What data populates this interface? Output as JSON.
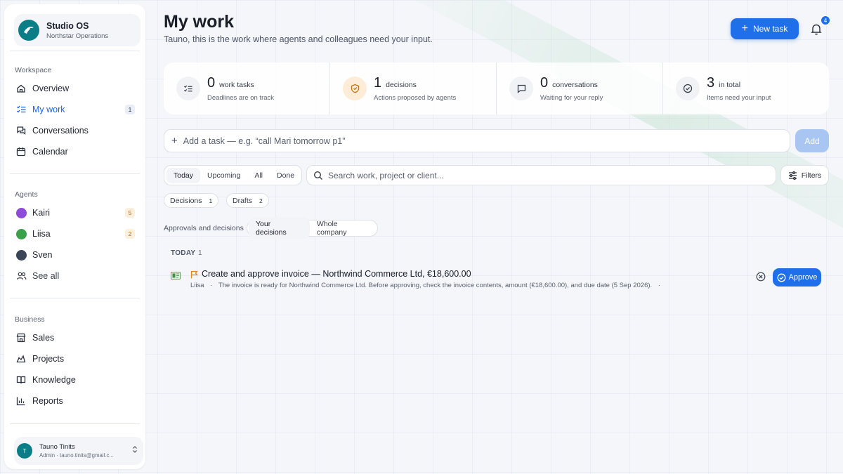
{
  "brand": {
    "name": "Studio OS",
    "org": "Northstar Operations"
  },
  "sidebar": {
    "workspace_label": "Workspace",
    "workspace_items": [
      {
        "label": "Overview",
        "icon": "home-icon"
      },
      {
        "label": "My work",
        "icon": "checklist-icon",
        "badge": "1",
        "active": true
      },
      {
        "label": "Conversations",
        "icon": "chat-icon"
      },
      {
        "label": "Calendar",
        "icon": "calendar-icon"
      }
    ],
    "agents_label": "Agents",
    "agents": [
      {
        "label": "Kairi",
        "badge": "5",
        "color": "#8e4ad8"
      },
      {
        "label": "Liisa",
        "badge": "2",
        "color": "#3aa04a"
      },
      {
        "label": "Sven",
        "color": "#3b4558"
      }
    ],
    "see_all": "See all",
    "business_label": "Business",
    "business_items": [
      {
        "label": "Sales",
        "icon": "store-icon"
      },
      {
        "label": "Projects",
        "icon": "projects-icon"
      },
      {
        "label": "Knowledge",
        "icon": "book-icon"
      },
      {
        "label": "Reports",
        "icon": "bar-chart-icon"
      }
    ],
    "user": {
      "initial": "T",
      "name": "Tauno Tinits",
      "subtitle": "Admin · tauno.tinits@gmail.c..."
    }
  },
  "header": {
    "title": "My work",
    "subtitle": "Tauno, this is the work where agents and colleagues need your input.",
    "new_task_label": "New task",
    "notifications_count": "4"
  },
  "stats": [
    {
      "value": "0",
      "label": "work tasks",
      "sub": "Deadlines are on track",
      "icon": "checklist-icon"
    },
    {
      "value": "1",
      "label": "decisions",
      "sub": "Actions proposed by agents",
      "icon": "shield-icon"
    },
    {
      "value": "0",
      "label": "conversations",
      "sub": "Waiting for your reply",
      "icon": "chat-icon"
    },
    {
      "value": "3",
      "label": "in total",
      "sub": "Items need your input",
      "icon": "check-circle-icon"
    }
  ],
  "add_task": {
    "placeholder": "Add a task — e.g. “call Mari tomorrow p1”",
    "button": "Add"
  },
  "tabs": [
    "Today",
    "Upcoming",
    "All",
    "Done"
  ],
  "search": {
    "placeholder": "Search work, project or client..."
  },
  "filters_label": "Filters",
  "chips": [
    {
      "label": "Decisions",
      "count": "1"
    },
    {
      "label": "Drafts",
      "count": "2"
    }
  ],
  "approvals": {
    "label": "Approvals and decisions",
    "options": [
      "Your decisions",
      "Whole company"
    ]
  },
  "group": {
    "heading": "TODAY",
    "count": "1"
  },
  "task": {
    "title": "Create and approve invoice — Northwind Commerce Ltd, €18,600.00",
    "agent": "Liisa",
    "description": "The invoice is ready for Northwind Commerce Ltd. Before approving, check the invoice contents, amount (€18,600.00), and due date (5 Sep 2026).",
    "approve_label": "Approve"
  },
  "colors": {
    "accent": "#1f6fea",
    "teal": "#0b7d86",
    "flag": "#e08a1e"
  }
}
